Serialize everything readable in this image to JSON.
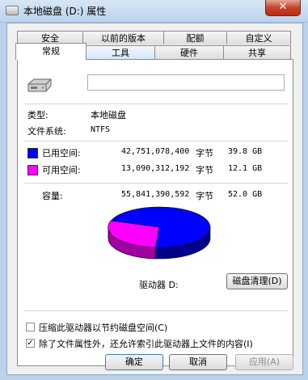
{
  "window": {
    "title": "本地磁盘 (D:) 属性",
    "close_label": "✕"
  },
  "tabs_row1": [
    "安全",
    "以前的版本",
    "配额",
    "自定义"
  ],
  "tabs_row2": [
    "常规",
    "工具",
    "硬件",
    "共享"
  ],
  "general": {
    "drive_name_value": "",
    "type_label": "类型:",
    "type_value": "本地磁盘",
    "fs_label": "文件系统:",
    "fs_value": "NTFS",
    "used": {
      "label": "已用空间:",
      "bytes": "42,751,078,400",
      "unit": "字节",
      "size": "39.8 GB",
      "color": "#0000ff"
    },
    "free": {
      "label": "可用空间:",
      "bytes": "13,090,312,192",
      "unit": "字节",
      "size": "12.1 GB",
      "color": "#ff00ff"
    },
    "capacity": {
      "label": "容量:",
      "bytes": "55,841,390,592",
      "unit": "字节",
      "size": "52.0 GB"
    },
    "drive_caption": "驱动器 D:",
    "cleanup_button": "磁盘清理(D)",
    "compress_label": "压缩此驱动器以节约磁盘空间(C)",
    "compress_checked": false,
    "index_label": "除了文件属性外，还允许索引此驱动器上文件的内容(I)",
    "index_checked": true
  },
  "buttons": {
    "ok": "确定",
    "cancel": "取消",
    "apply": "应用(A)"
  }
}
